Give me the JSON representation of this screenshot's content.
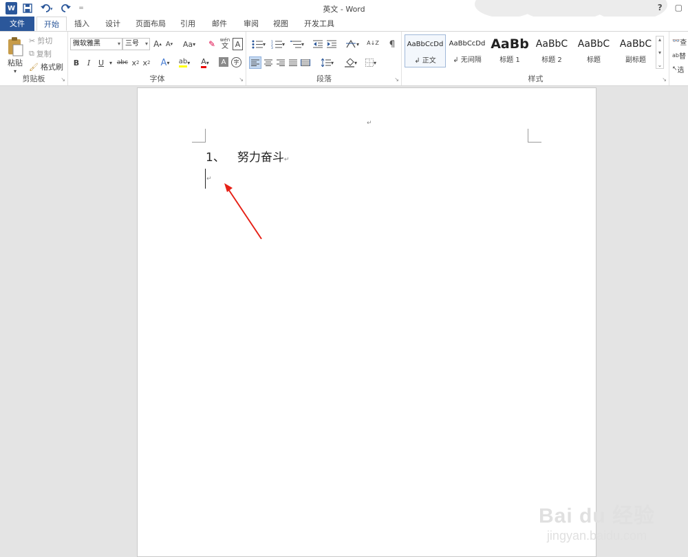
{
  "window": {
    "title": "英文 - Word",
    "help": "?",
    "restore": "▢"
  },
  "quick_access": {
    "app_icon": "W",
    "save_icon": "save-icon",
    "undo_icon": "undo-icon",
    "redo_icon": "redo-icon",
    "more": "="
  },
  "tabs": [
    "文件",
    "开始",
    "插入",
    "设计",
    "页面布局",
    "引用",
    "邮件",
    "审阅",
    "视图",
    "开发工具"
  ],
  "active_tab": "开始",
  "clipboard": {
    "paste": "粘贴",
    "cut": "剪切",
    "copy": "复制",
    "format_painter": "格式刷",
    "label": "剪贴板"
  },
  "font": {
    "family": "微软雅黑",
    "size": "三号",
    "label": "字体",
    "grow": "A",
    "shrink": "A",
    "case": "Aa",
    "phonetic_top": "wén",
    "phonetic_bottom": "文",
    "border_char": "A",
    "bold": "B",
    "italic": "I",
    "underline": "U",
    "strike": "abc",
    "sub": "x",
    "sup": "x",
    "effects": "A",
    "highlight": "ab",
    "color": "A",
    "shade": "A",
    "enclose": "字"
  },
  "paragraph": {
    "label": "段落",
    "sort": "A↓Z"
  },
  "styles": {
    "label": "样式",
    "items": [
      {
        "sample": "AaBbCcDd",
        "name": "正文"
      },
      {
        "sample": "AaBbCcDd",
        "name": "无间隔"
      },
      {
        "sample": "AaBb",
        "name": "标题 1"
      },
      {
        "sample": "AaBbC",
        "name": "标题 2"
      },
      {
        "sample": "AaBbC",
        "name": "标题"
      },
      {
        "sample": "AaBbC",
        "name": "副标题"
      }
    ]
  },
  "editing": {
    "find": "查",
    "replace": "替",
    "select": "选"
  },
  "document": {
    "list_number": "1、",
    "text": "努力奋斗",
    "para_mark": "↵"
  },
  "watermark": {
    "logo": "Bai du 经验",
    "url": "jingyan.baidu.com"
  },
  "colors": {
    "accent": "#2b579a",
    "arrow": "#e62117"
  }
}
